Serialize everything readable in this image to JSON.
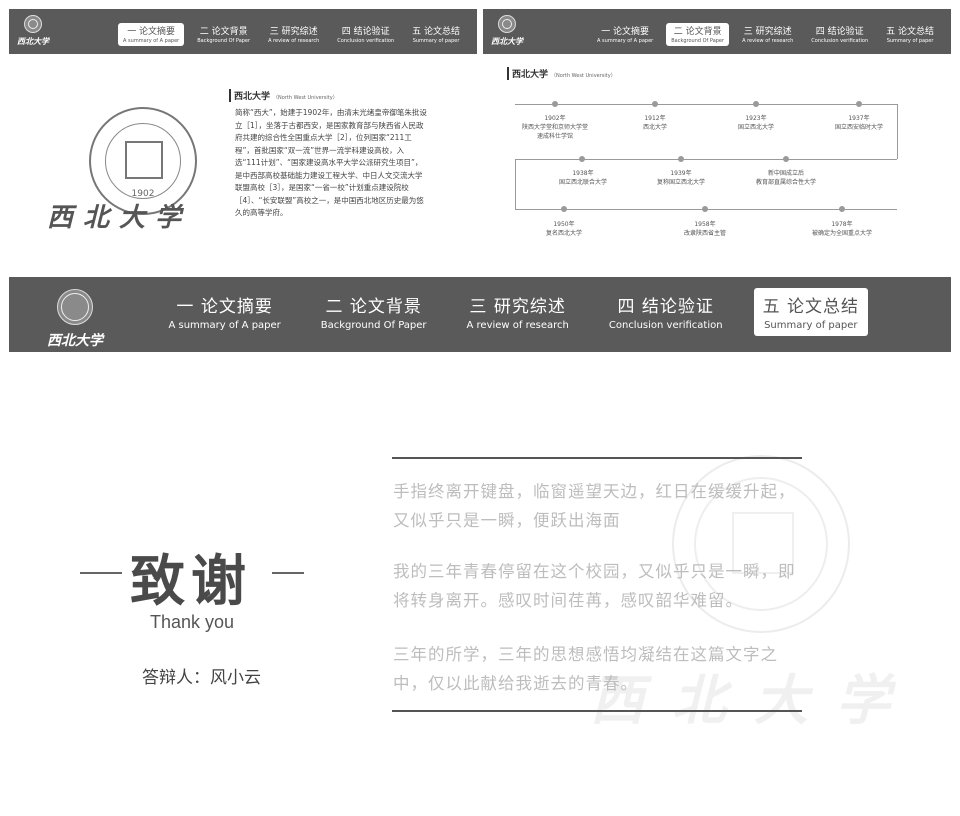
{
  "logo": {
    "calligraphy": "西北大学",
    "seal_year": "1902"
  },
  "nav": [
    {
      "cn": "一 论文摘要",
      "en": "A summary of A paper"
    },
    {
      "cn": "二 论文背景",
      "en": "Background Of Paper"
    },
    {
      "cn": "三 研究综述",
      "en": "A review of research"
    },
    {
      "cn": "四 结论验证",
      "en": "Conclusion verification"
    },
    {
      "cn": "五 论文总结",
      "en": "Summary of paper"
    }
  ],
  "slide1": {
    "section_title": "西北大学",
    "section_sub": "（North West University）",
    "intro": "简称“西大”，始建于1902年，由清末光绪皇帝御笔朱批设立［1］，坐落于古都西安，是国家教育部与陕西省人民政府共建的综合性全国重点大学［2］，位列国家“211工程”，首批国家“双一流”世界一流学科建设高校，入选“111计划”、“国家建设高水平大学公派研究生项目”，是中西部高校基础能力建设工程大学、中日人文交流大学联盟高校［3］，是国家“一省一校”计划重点建设院校［4］、“长安联盟”高校之一，是中国西北地区历史最为悠久的高等学府。"
  },
  "slide2": {
    "section_title": "西北大学",
    "section_sub": "（North West University）",
    "timeline": [
      {
        "year": "1902年",
        "desc": "陕西大学堂和京师大学堂\n速成科仕学馆"
      },
      {
        "year": "1912年",
        "desc": "西北大学"
      },
      {
        "year": "1923年",
        "desc": "国立西北大学"
      },
      {
        "year": "1937年",
        "desc": "国立西安临时大学"
      },
      {
        "year": "1938年",
        "desc": "国立西北联合大学"
      },
      {
        "year": "1939年",
        "desc": "复称国立西北大学"
      },
      {
        "year": "新中国成立后",
        "desc": "教育部直属综合性大学"
      },
      {
        "year": "1950年",
        "desc": "复名西北大学"
      },
      {
        "year": "1958年",
        "desc": "改隶陕西省主管"
      },
      {
        "year": "1978年",
        "desc": "被确定为全国重点大学"
      }
    ]
  },
  "slide3": {
    "title": "致谢",
    "subtitle": "Thank you",
    "defender": "答辩人：风小云",
    "paragraphs": [
      "手指终离开键盘，临窗遥望天边，红日在缓缓升起，又似乎只是一瞬，便跃出海面",
      "我的三年青春停留在这个校园，又似乎只是一瞬，即将转身离开。感叹时间荏苒，感叹韶华难留。",
      "三年的所学，三年的思想感悟均凝结在这篇文字之中，仅以此献给我逝去的青春。"
    ]
  },
  "colors": {
    "navbar": "#5a5a5a",
    "accent": "#ffffff",
    "faint_text": "#bdbdbd"
  }
}
